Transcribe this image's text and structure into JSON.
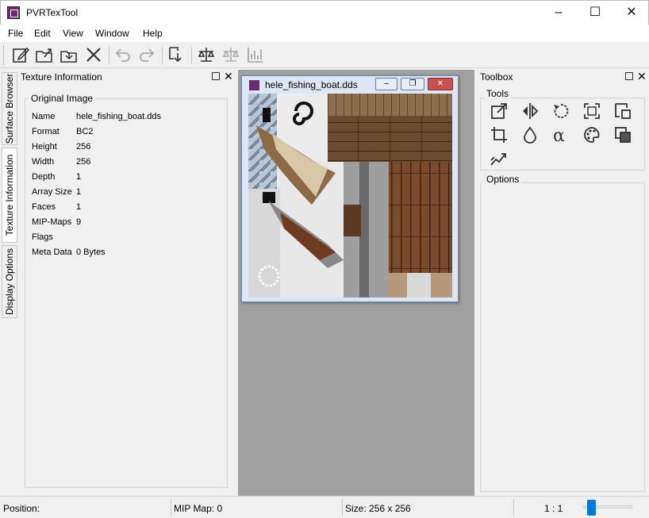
{
  "window": {
    "title": "PVRTexTool"
  },
  "menu": [
    "File",
    "Edit",
    "View",
    "Window",
    "Help"
  ],
  "side_tabs": [
    "Surface Browser",
    "Texture Information",
    "Display Options"
  ],
  "texture_info": {
    "panel_title": "Texture Information",
    "group_title": "Original Image",
    "rows": [
      {
        "key": "Name",
        "value": "hele_fishing_boat.dds"
      },
      {
        "key": "Format",
        "value": "BC2"
      },
      {
        "key": "Height",
        "value": "256"
      },
      {
        "key": "Width",
        "value": "256"
      },
      {
        "key": "Depth",
        "value": "1"
      },
      {
        "key": "Array Size",
        "value": "1"
      },
      {
        "key": "Faces",
        "value": "1"
      },
      {
        "key": "MIP-Maps",
        "value": "9"
      },
      {
        "key": "Flags",
        "value": ""
      },
      {
        "key": "Meta Data",
        "value": "0 Bytes"
      }
    ]
  },
  "image_window": {
    "title": "hele_fishing_boat.dds"
  },
  "toolbox": {
    "panel_title": "Toolbox",
    "tools_label": "Tools",
    "options_label": "Options",
    "tools": [
      "resize-icon",
      "flip-icon",
      "rotate-icon",
      "fit-icon",
      "copy-icon",
      "crop-icon",
      "drop-icon",
      "alpha-icon",
      "palette-icon",
      "layers-icon",
      "chart-icon"
    ]
  },
  "status": {
    "position_label": "Position:",
    "mip_map": "MIP Map: 0",
    "size": "Size: 256 x 256",
    "zoom": "1 : 1",
    "zoom_level": 0.1
  },
  "colors": {
    "accent": "#0078d7",
    "app_icon": "#6b2c6e",
    "mdi_area": "#a0a0a0"
  }
}
